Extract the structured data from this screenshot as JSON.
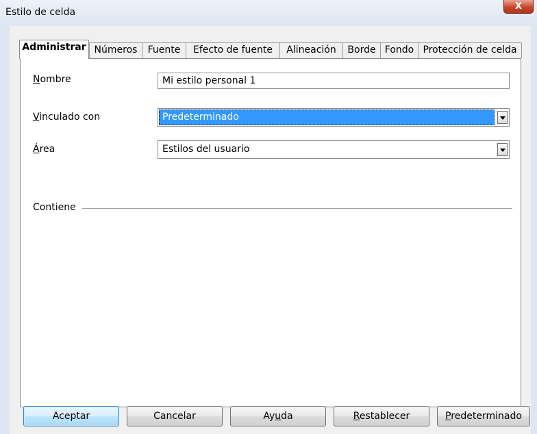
{
  "window": {
    "title": "Estilo de celda",
    "close_glyph": "X"
  },
  "tabs": [
    {
      "label": "Administrar",
      "active": true
    },
    {
      "label": "Números",
      "active": false
    },
    {
      "label": "Fuente",
      "active": false
    },
    {
      "label": "Efecto de fuente",
      "active": false
    },
    {
      "label": "Alineación",
      "active": false
    },
    {
      "label": "Borde",
      "active": false
    },
    {
      "label": "Fondo",
      "active": false
    },
    {
      "label": "Protección de celda",
      "active": false
    }
  ],
  "form": {
    "name_label_first": "N",
    "name_label_rest": "ombre",
    "name_value": "Mi estilo personal 1",
    "linked_label_first": "V",
    "linked_label_rest": "inculado con",
    "linked_value": "Predeterminado",
    "area_label_first": "Á",
    "area_label_rest": "rea",
    "area_value": "Estilos del usuario",
    "contains_label": "Contiene"
  },
  "buttons": {
    "ok": "Aceptar",
    "cancel": "Cancelar",
    "help_pre": "Ay",
    "help_u": "u",
    "help_post": "da",
    "reset_u": "R",
    "reset_post": "establecer",
    "default_u": "P",
    "default_post": "redeterminado"
  },
  "colors": {
    "selection": "#3399ff",
    "close_button": "#c9462c",
    "frame": "#dde6f1"
  }
}
